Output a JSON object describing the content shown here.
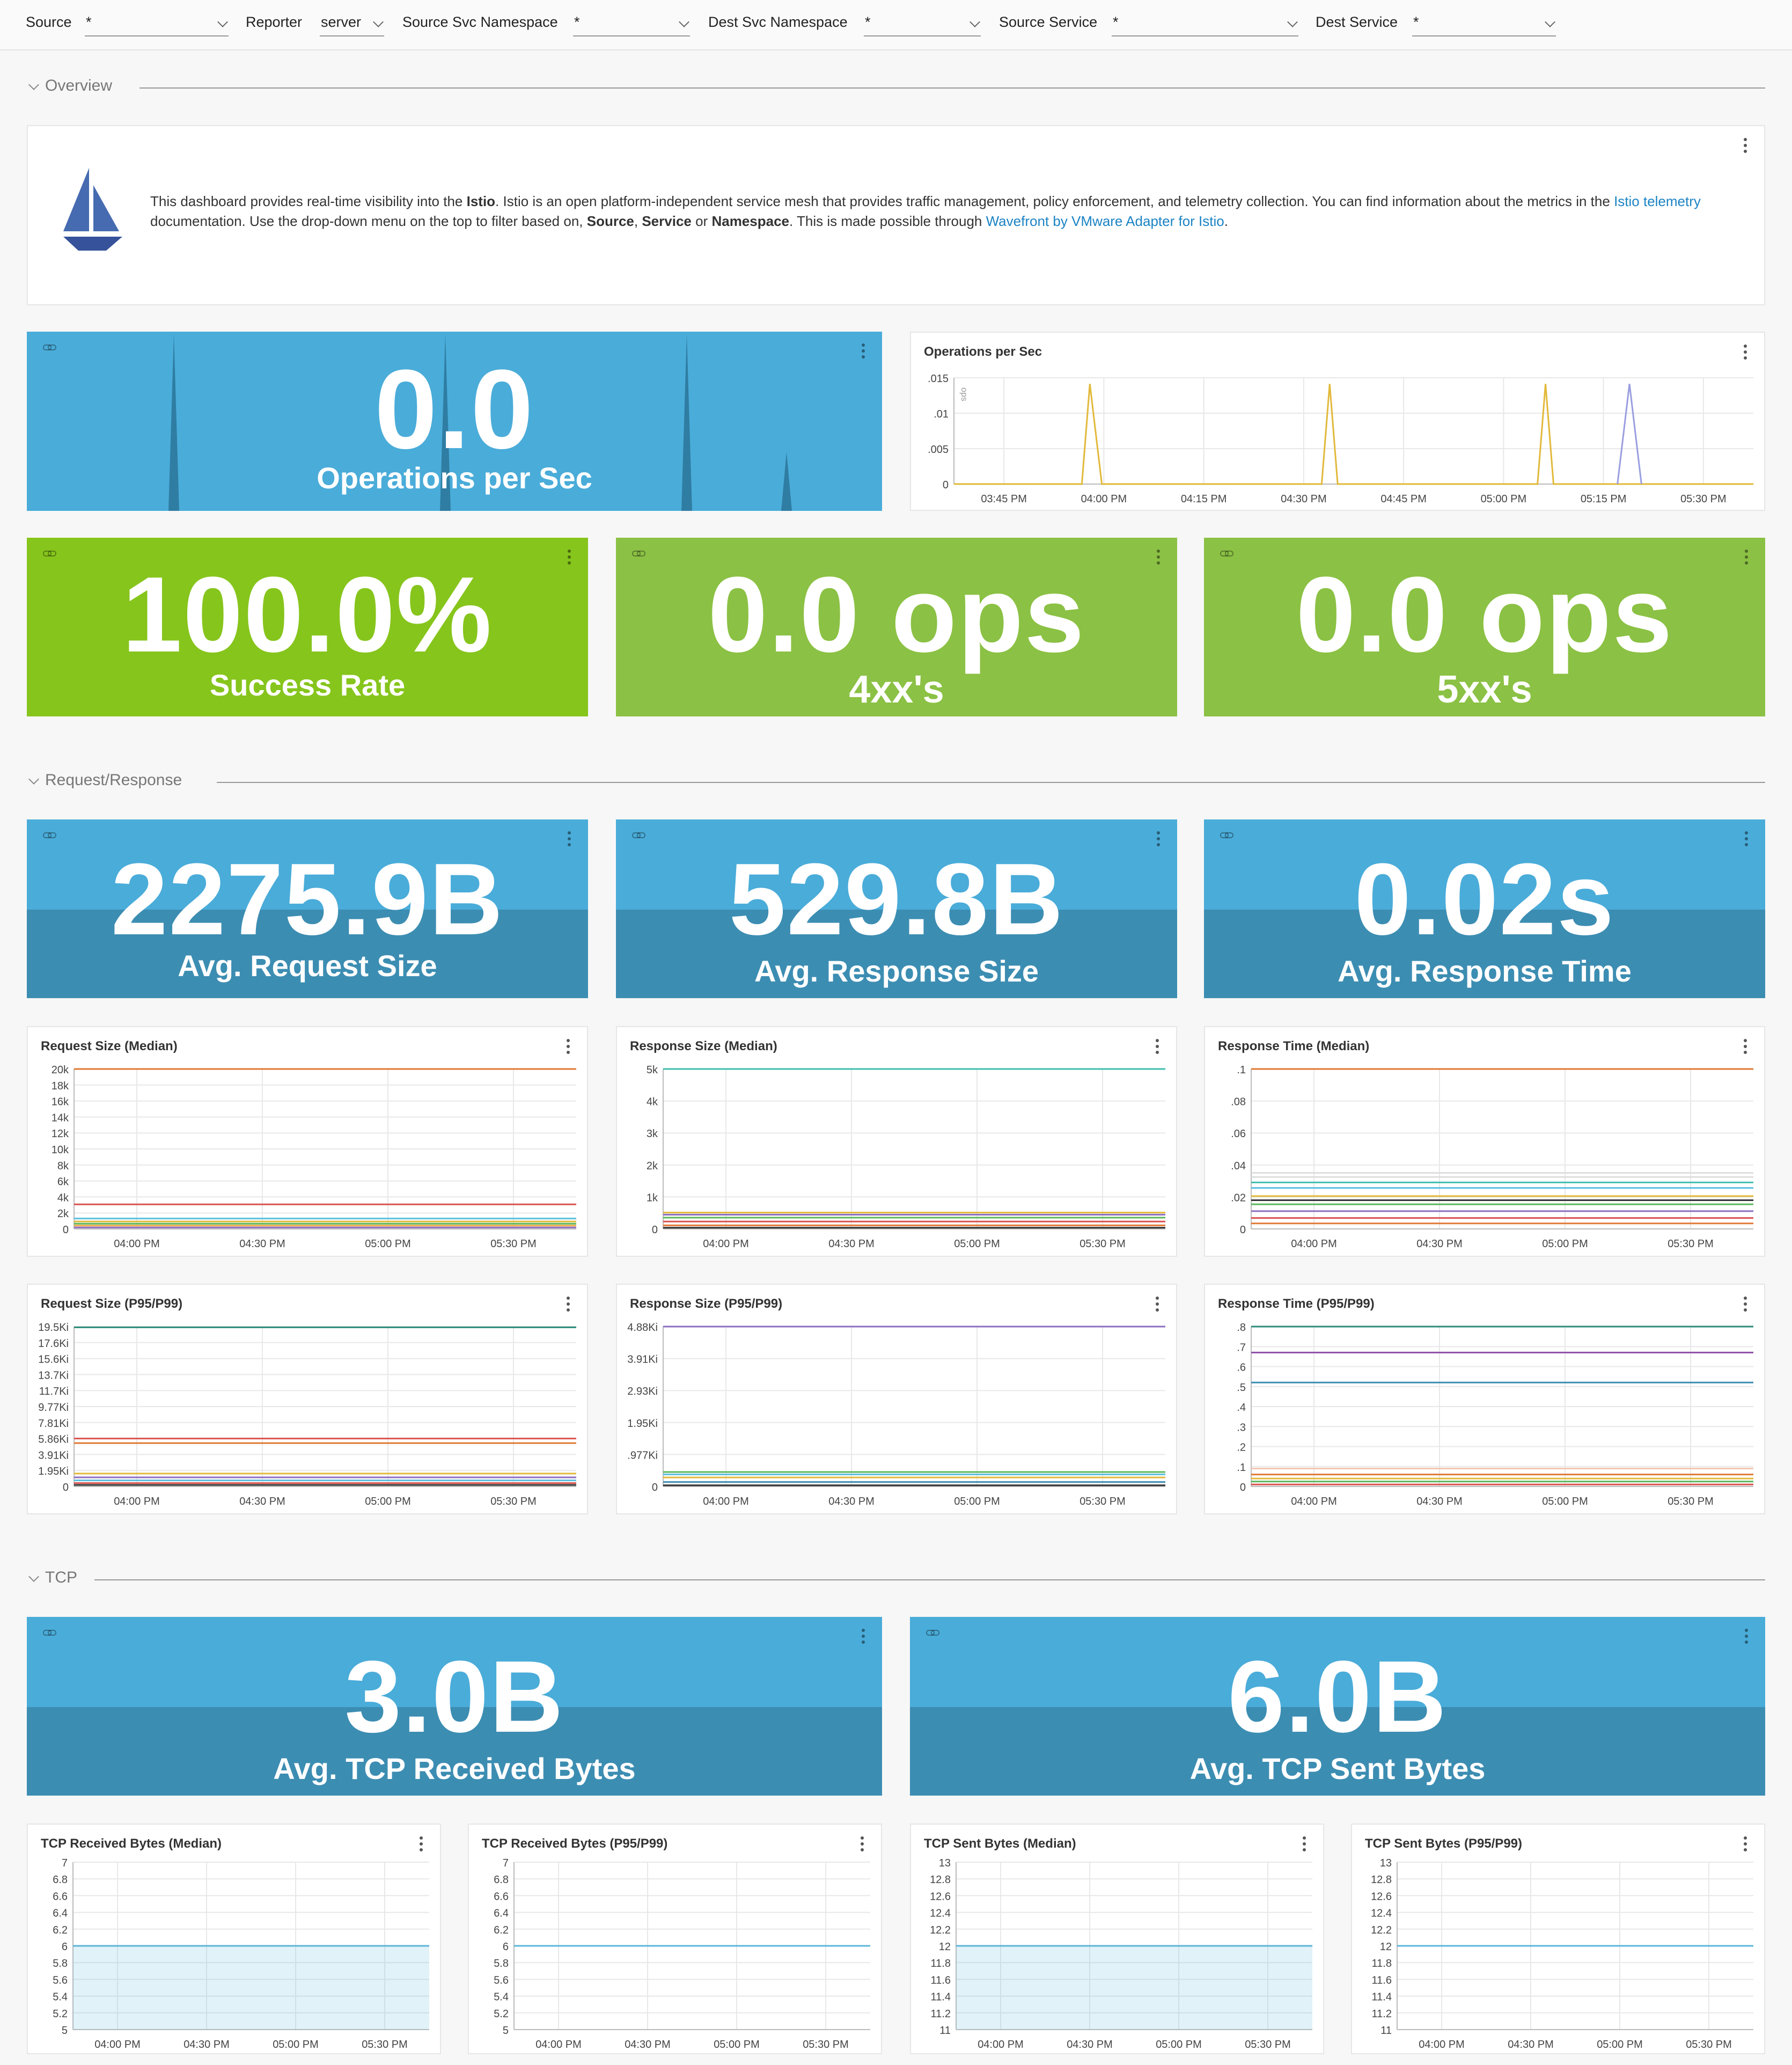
{
  "filters": [
    {
      "label": "Source",
      "value": "*"
    },
    {
      "label": "Reporter",
      "value": "server"
    },
    {
      "label": "Source Svc Namespace",
      "value": "*"
    },
    {
      "label": "Dest Svc Namespace",
      "value": "*"
    },
    {
      "label": "Source Service",
      "value": "*"
    },
    {
      "label": "Dest Service",
      "value": "*"
    }
  ],
  "sections": {
    "overview": "Overview",
    "request_response": "Request/Response",
    "tcp": "TCP"
  },
  "intro": {
    "t1": "This dashboard provides real-time visibility into the ",
    "b1": "Istio",
    "t2": ". Istio is an open platform-independent service mesh that provides traffic management, policy enforcement, and telemetry collection. You can find information about the metrics in the ",
    "l1": "Istio telemetry",
    "t3": " documentation. Use the drop-down menu on the top to filter based on, ",
    "b2": "Source",
    "t4": ", ",
    "b3": "Service",
    "t5": " or ",
    "b4": "Namespace",
    "t6": ". This is made possible through ",
    "l2": "Wavefront by VMware Adapter for Istio",
    "t7": "."
  },
  "stats": {
    "ops": {
      "value": "0.0",
      "label": "Operations per Sec"
    },
    "success": {
      "value": "100.0%",
      "label": "Success Rate"
    },
    "e4xx": {
      "value": "0.0 ops",
      "label": "4xx's"
    },
    "e5xx": {
      "value": "0.0 ops",
      "label": "5xx's"
    },
    "req_size": {
      "value": "2275.9B",
      "label": "Avg. Request Size"
    },
    "resp_size": {
      "value": "529.8B",
      "label": "Avg. Response Size"
    },
    "resp_time": {
      "value": "0.02s",
      "label": "Avg. Response Time"
    },
    "tcp_recv": {
      "value": "3.0B",
      "label": "Avg. TCP Received Bytes"
    },
    "tcp_sent": {
      "value": "6.0B",
      "label": "Avg. TCP Sent Bytes"
    }
  },
  "colors": {
    "blue_tile": "#4aacd9",
    "blue_band": "#3c8db2",
    "green_bright": "#86c51c",
    "green": "#8bc144",
    "link": "#1b83c4"
  },
  "chart_data": [
    {
      "id": "ops",
      "type": "line",
      "title": "Operations per Sec",
      "ylabel": "ops",
      "xticks": [
        "03:45 PM",
        "04:00 PM",
        "04:15 PM",
        "04:30 PM",
        "04:45 PM",
        "05:00 PM",
        "05:15 PM",
        "05:30 PM"
      ],
      "yticks": [
        ".015",
        ".01",
        ".005",
        "0"
      ],
      "ylim": [
        0,
        0.0175
      ],
      "series": [
        {
          "color": "#e2b93b",
          "points": [
            [
              0,
              0
            ],
            [
              0.16,
              0
            ],
            [
              0.17,
              0.0165
            ],
            [
              0.185,
              0
            ],
            [
              0.46,
              0
            ],
            [
              0.47,
              0.0165
            ],
            [
              0.48,
              0
            ],
            [
              0.73,
              0
            ],
            [
              0.74,
              0.0165
            ],
            [
              0.75,
              0
            ],
            [
              1,
              0
            ]
          ]
        },
        {
          "color": "#9a9ee0",
          "points": [
            [
              0.83,
              0
            ],
            [
              0.845,
              0.0165
            ],
            [
              0.86,
              0
            ]
          ]
        }
      ]
    },
    {
      "id": "req_median",
      "type": "line",
      "title": "Request Size (Median)",
      "xticks": [
        "04:00 PM",
        "04:30 PM",
        "05:00 PM",
        "05:30 PM"
      ],
      "yticks": [
        "20k",
        "18k",
        "16k",
        "14k",
        "12k",
        "10k",
        "8k",
        "6k",
        "4k",
        "2k",
        "0"
      ],
      "ylim": [
        0,
        21500
      ],
      "series": [
        {
          "color": "#e07a35",
          "value": 21500
        },
        {
          "color": "#d9534f",
          "value": 3300
        },
        {
          "color": "#5bc0de",
          "value": 1400
        },
        {
          "color": "#e2b93b",
          "value": 1000
        },
        {
          "color": "#5cb85c",
          "value": 700
        },
        {
          "color": "#f0ad4e",
          "value": 450
        },
        {
          "color": "#8e6fc0",
          "value": 200
        }
      ]
    },
    {
      "id": "resp_median",
      "type": "line",
      "title": "Response Size (Median)",
      "xticks": [
        "04:00 PM",
        "04:30 PM",
        "05:00 PM",
        "05:30 PM"
      ],
      "yticks": [
        "5k",
        "4k",
        "3k",
        "2k",
        "1k",
        "0"
      ],
      "ylim": [
        0,
        5400
      ],
      "series": [
        {
          "color": "#3fbfae",
          "value": 5400
        },
        {
          "color": "#e2b93b",
          "value": 550
        },
        {
          "color": "#8e6fc0",
          "value": 480
        },
        {
          "color": "#5cb85c",
          "value": 380
        },
        {
          "color": "#d9534f",
          "value": 250
        },
        {
          "color": "#e07a35",
          "value": 120
        },
        {
          "color": "#333333",
          "value": 40
        }
      ]
    },
    {
      "id": "rt_median",
      "type": "line",
      "title": "Response Time (Median)",
      "xticks": [
        "04:00 PM",
        "04:30 PM",
        "05:00 PM",
        "05:30 PM"
      ],
      "yticks": [
        ".1",
        ".08",
        ".06",
        ".04",
        ".02",
        "0"
      ],
      "ylim": [
        0,
        0.117
      ],
      "series": [
        {
          "color": "#e07a35",
          "value": 0.117
        },
        {
          "color": "#dddddd",
          "value": 0.041
        },
        {
          "color": "#dddddd",
          "value": 0.038
        },
        {
          "color": "#3fbfae",
          "value": 0.034
        },
        {
          "color": "#5bc0de",
          "value": 0.03
        },
        {
          "color": "#e2b93b",
          "value": 0.024
        },
        {
          "color": "#333333",
          "value": 0.021
        },
        {
          "color": "#5cb85c",
          "value": 0.018
        },
        {
          "color": "#8e6fc0",
          "value": 0.013
        },
        {
          "color": "#d9534f",
          "value": 0.008
        },
        {
          "color": "#e07a35",
          "value": 0.004
        }
      ]
    },
    {
      "id": "req_p95",
      "type": "line",
      "title": "Request Size (P95/P99)",
      "xticks": [
        "04:00 PM",
        "04:30 PM",
        "05:00 PM",
        "05:30 PM"
      ],
      "yticks": [
        "19.5Ki",
        "17.6Ki",
        "15.6Ki",
        "13.7Ki",
        "11.7Ki",
        "9.77Ki",
        "7.81Ki",
        "5.86Ki",
        "3.91Ki",
        "1.95Ki",
        "0"
      ],
      "ylim": [
        0,
        21000
      ],
      "series": [
        {
          "color": "#2e8b7a",
          "value": 20900
        },
        {
          "color": "#d9534f",
          "value": 6300
        },
        {
          "color": "#e07a35",
          "value": 5700
        },
        {
          "color": "#e2b93b",
          "value": 1700
        },
        {
          "color": "#8e6fc0",
          "value": 1200
        },
        {
          "color": "#5bc0de",
          "value": 800
        },
        {
          "color": "#d9534f",
          "value": 450
        },
        {
          "color": "#333333",
          "value": 200
        }
      ]
    },
    {
      "id": "resp_p95",
      "type": "line",
      "title": "Response Size (P95/P99)",
      "xticks": [
        "04:00 PM",
        "04:30 PM",
        "05:00 PM",
        "05:30 PM"
      ],
      "yticks": [
        "4.88Ki",
        "3.91Ki",
        "2.93Ki",
        "1.95Ki",
        ".977Ki",
        "0"
      ],
      "ylim": [
        0,
        5300
      ],
      "series": [
        {
          "color": "#8e6fc0",
          "value": 5300
        },
        {
          "color": "#5cb85c",
          "value": 480
        },
        {
          "color": "#5bc0de",
          "value": 400
        },
        {
          "color": "#e2b93b",
          "value": 300
        },
        {
          "color": "#3c8db2",
          "value": 150
        },
        {
          "color": "#333333",
          "value": 40
        }
      ]
    },
    {
      "id": "rt_p95",
      "type": "line",
      "title": "Response Time (P95/P99)",
      "xticks": [
        "04:00 PM",
        "04:30 PM",
        "05:00 PM",
        "05:30 PM"
      ],
      "yticks": [
        ".8",
        ".7",
        ".6",
        ".5",
        ".4",
        ".3",
        ".2",
        ".1",
        "0"
      ],
      "ylim": [
        0,
        0.8
      ],
      "series": [
        {
          "color": "#2e8b7a",
          "value": 0.8
        },
        {
          "color": "#8e4fa8",
          "value": 0.67
        },
        {
          "color": "#3c8db2",
          "value": 0.52
        },
        {
          "color": "#f3c6b4",
          "value": 0.09
        },
        {
          "color": "#e07a35",
          "value": 0.06
        },
        {
          "color": "#e2b93b",
          "value": 0.04
        },
        {
          "color": "#5cb85c",
          "value": 0.025
        },
        {
          "color": "#d9534f",
          "value": 0.01
        }
      ]
    },
    {
      "id": "tcp_recv_median",
      "type": "area",
      "title": "TCP Received Bytes (Median)",
      "xticks": [
        "04:00 PM",
        "04:30 PM",
        "05:00 PM",
        "05:30 PM"
      ],
      "yticks": [
        "7",
        "6.8",
        "6.6",
        "6.4",
        "6.2",
        "6",
        "5.8",
        "5.6",
        "5.4",
        "5.2",
        "5"
      ],
      "ylim": [
        5,
        7
      ],
      "series": [
        {
          "color": "#5bb5d9",
          "value": 6
        }
      ]
    },
    {
      "id": "tcp_recv_p95",
      "type": "line",
      "title": "TCP Received Bytes (P95/P99)",
      "xticks": [
        "04:00 PM",
        "04:30 PM",
        "05:00 PM",
        "05:30 PM"
      ],
      "yticks": [
        "7",
        "6.8",
        "6.6",
        "6.4",
        "6.2",
        "6",
        "5.8",
        "5.6",
        "5.4",
        "5.2",
        "5"
      ],
      "ylim": [
        5,
        7
      ],
      "series": [
        {
          "color": "#5bb5d9",
          "value": 6
        }
      ]
    },
    {
      "id": "tcp_sent_median",
      "type": "area",
      "title": "TCP Sent Bytes (Median)",
      "xticks": [
        "04:00 PM",
        "04:30 PM",
        "05:00 PM",
        "05:30 PM"
      ],
      "yticks": [
        "13",
        "12.8",
        "12.6",
        "12.4",
        "12.2",
        "12",
        "11.8",
        "11.6",
        "11.4",
        "11.2",
        "11"
      ],
      "ylim": [
        11,
        13
      ],
      "series": [
        {
          "color": "#5bb5d9",
          "value": 12
        }
      ]
    },
    {
      "id": "tcp_sent_p95",
      "type": "line",
      "title": "TCP Sent Bytes (P95/P99)",
      "xticks": [
        "04:00 PM",
        "04:30 PM",
        "05:00 PM",
        "05:30 PM"
      ],
      "yticks": [
        "13",
        "12.8",
        "12.6",
        "12.4",
        "12.2",
        "12",
        "11.8",
        "11.6",
        "11.4",
        "11.2",
        "11"
      ],
      "ylim": [
        11,
        13
      ],
      "series": [
        {
          "color": "#5bb5d9",
          "value": 12
        }
      ]
    }
  ]
}
